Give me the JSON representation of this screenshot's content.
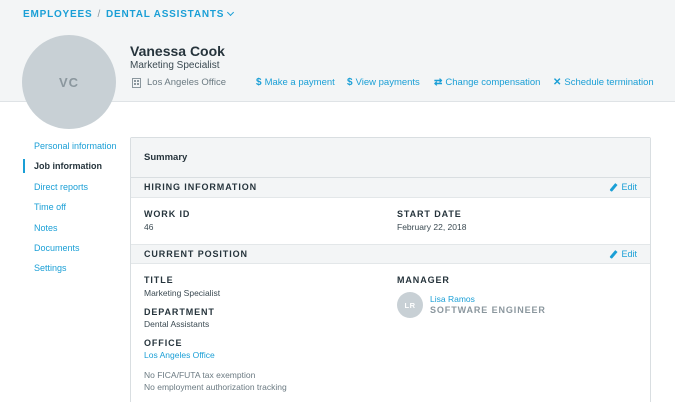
{
  "breadcrumb": {
    "root": "EMPLOYEES",
    "separator": "/",
    "current": "DENTAL ASSISTANTS"
  },
  "profile": {
    "initials": "VC",
    "name": "Vanessa Cook",
    "role": "Marketing Specialist",
    "office": "Los Angeles Office"
  },
  "actions": {
    "make_payment": {
      "icon": "$",
      "label": "Make a payment"
    },
    "view_payments": {
      "icon": "$",
      "label": "View payments"
    },
    "change_compensation": {
      "icon": "⇄",
      "label": "Change compensation"
    },
    "schedule_termination": {
      "icon": "✕",
      "label": "Schedule termination"
    }
  },
  "nav": {
    "items": [
      {
        "label": "Personal information"
      },
      {
        "label": "Job information"
      },
      {
        "label": "Direct reports"
      },
      {
        "label": "Time off"
      },
      {
        "label": "Notes"
      },
      {
        "label": "Documents"
      },
      {
        "label": "Settings"
      }
    ],
    "active": "Job information"
  },
  "summary": {
    "title": "Summary",
    "hiring": {
      "heading": "HIRING INFORMATION",
      "edit_label": "Edit",
      "work_id_label": "WORK ID",
      "work_id": "46",
      "start_date_label": "START DATE",
      "start_date": "February 22, 2018"
    },
    "position": {
      "heading": "CURRENT POSITION",
      "edit_label": "Edit",
      "title_label": "TITLE",
      "title": "Marketing Specialist",
      "department_label": "DEPARTMENT",
      "department": "Dental Assistants",
      "office_label": "OFFICE",
      "office": "Los Angeles Office",
      "note_1": "No FICA/FUTA tax exemption",
      "note_2": "No employment authorization tracking",
      "manager_label": "MANAGER",
      "manager_initials": "LR",
      "manager_name": "Lisa Ramos",
      "manager_title": "SOFTWARE ENGINEER"
    }
  },
  "colors": {
    "accent": "#1a9fd6",
    "header_bg": "#f3f5f6",
    "avatar": "#c8d0d5",
    "text": "#26343c"
  }
}
